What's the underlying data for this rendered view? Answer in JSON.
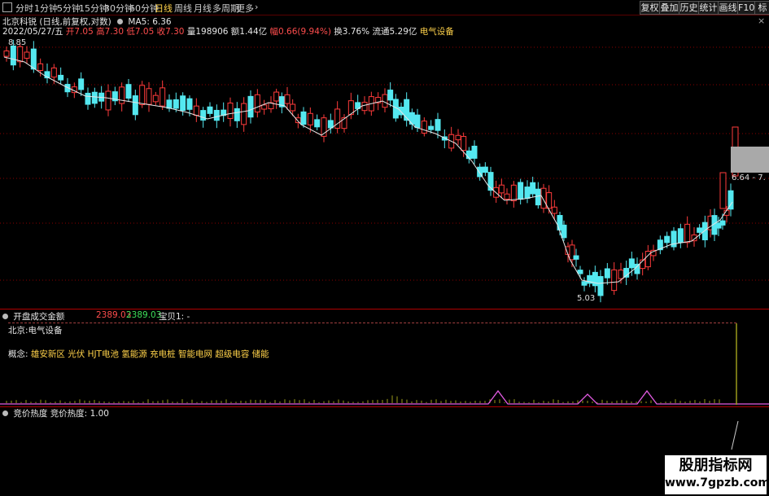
{
  "toolbar": {
    "menu_icon": "menu-icon",
    "periods": [
      "分时",
      "1分钟",
      "5分钟",
      "15分钟",
      "30分钟",
      "60分钟",
      "日线",
      "周线",
      "月线",
      "多周期",
      "更多"
    ],
    "active_period": "日线",
    "right_buttons": [
      "复权",
      "叠加",
      "历史",
      "统计",
      "画线",
      "F10",
      "标记"
    ]
  },
  "info": {
    "stock": "北京科锐",
    "mode": "(日线,前复权,对数)",
    "ma_label": "MA5:",
    "ma_value": "6.36",
    "date": "2022/05/27/五",
    "open_label": "开",
    "open": "7.05",
    "high_label": "高",
    "high": "7.30",
    "low_label": "低",
    "low": "7.05",
    "close_label": "收",
    "close": "7.30",
    "vol_label": "量",
    "vol": "198906",
    "amount_label": "额",
    "amount": "1.44亿",
    "change_label": "幅",
    "change": "0.66(9.94%)",
    "turnover_label": "换",
    "turnover": "3.76%",
    "float_label": "流通",
    "float": "5.29亿",
    "sector": "电气设备"
  },
  "main_chart": {
    "high_mark": "8.85",
    "low_mark": "5.03",
    "price_box": "6.64 - 7."
  },
  "panel1": {
    "title": "开盘成交金额",
    "v1": "2389.03",
    "v2": "2389.03",
    "v3": "宝贝1: -",
    "region": "北京:电气设备",
    "concepts_label": "概念:",
    "concepts": "雄安新区  光伏  HJT电池  氢能源  充电桩  智能电网  超级电容  储能"
  },
  "panel2": {
    "title": "竞价热度",
    "label": "竞价热度:",
    "value": "1.00"
  },
  "watermark": {
    "line1": "股朋指标网",
    "line2": "www.7gpzb.com"
  },
  "colors": {
    "up": "#ff3b3b",
    "down": "#54e8f0",
    "ma": "#e6e6e6",
    "grid": "#8a0000",
    "purple": "#e35be3"
  }
}
